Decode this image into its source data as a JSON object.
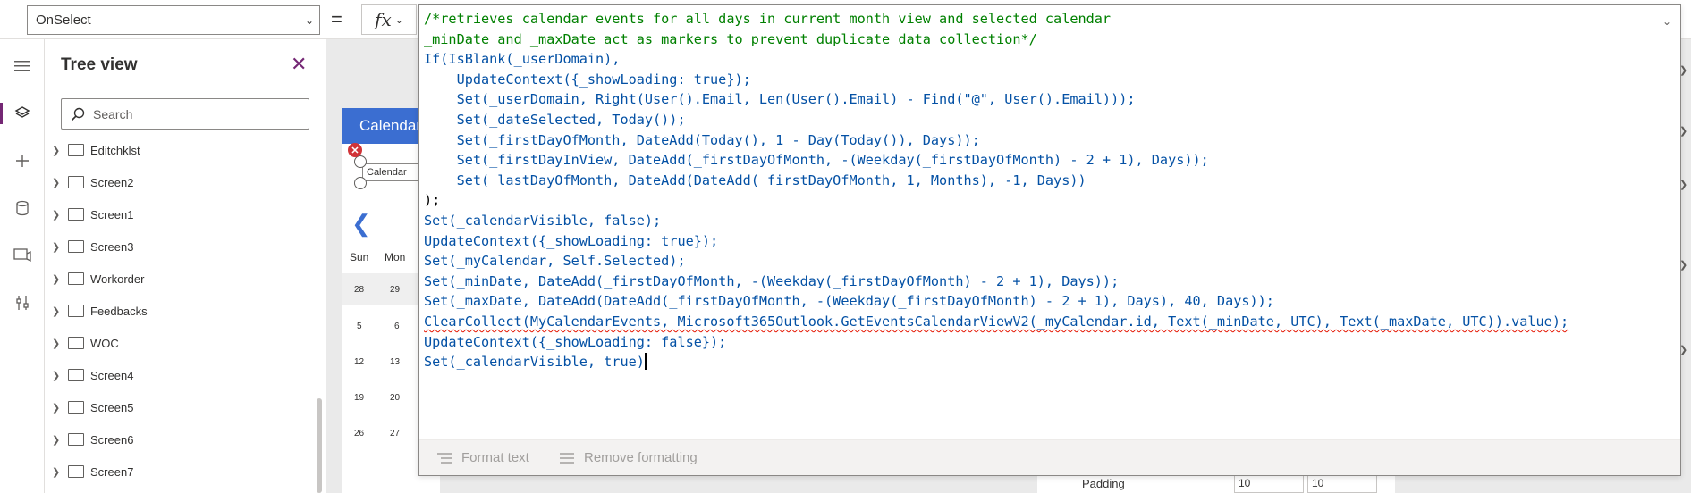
{
  "formula_bar": {
    "property": "OnSelect",
    "equals": "=",
    "fx": "fx"
  },
  "tree": {
    "title": "Tree view",
    "search_placeholder": "Search",
    "items": [
      {
        "label": "Editchklst"
      },
      {
        "label": "Screen2"
      },
      {
        "label": "Screen1"
      },
      {
        "label": "Screen3"
      },
      {
        "label": "Workorder"
      },
      {
        "label": "Feedbacks"
      },
      {
        "label": "WOC"
      },
      {
        "label": "Screen4"
      },
      {
        "label": "Screen5"
      },
      {
        "label": "Screen6"
      },
      {
        "label": "Screen7"
      }
    ]
  },
  "canvas": {
    "header": "Calendar",
    "chip": "Calendar",
    "days_of_week": [
      "Sun",
      "Mon"
    ],
    "day_rows": [
      [
        "28",
        "29"
      ],
      [
        "5",
        "6"
      ],
      [
        "12",
        "13"
      ],
      [
        "19",
        "20"
      ],
      [
        "26",
        "27"
      ]
    ]
  },
  "properties": {
    "padding_label": "Padding",
    "padding_values": [
      "10",
      "10"
    ]
  },
  "editor": {
    "lines": [
      "/*retrieves calendar events for all days in current month view and selected calendar",
      "_minDate and _maxDate act as markers to prevent duplicate data collection*/",
      "If(IsBlank(_userDomain),",
      "    UpdateContext({_showLoading: true});",
      "    Set(_userDomain, Right(User().Email, Len(User().Email) - Find(\"@\", User().Email)));",
      "    Set(_dateSelected, Today());",
      "    Set(_firstDayOfMonth, DateAdd(Today(), 1 - Day(Today()), Days));",
      "    Set(_firstDayInView, DateAdd(_firstDayOfMonth, -(Weekday(_firstDayOfMonth) - 2 + 1), Days));",
      "    Set(_lastDayOfMonth, DateAdd(DateAdd(_firstDayOfMonth, 1, Months), -1, Days))",
      ");",
      "Set(_calendarVisible, false);",
      "UpdateContext({_showLoading: true});",
      "Set(_myCalendar, Self.Selected);",
      "Set(_minDate, DateAdd(_firstDayOfMonth, -(Weekday(_firstDayOfMonth) - 2 + 1), Days));",
      "Set(_maxDate, DateAdd(DateAdd(_firstDayOfMonth, -(Weekday(_firstDayOfMonth) - 2 + 1), Days), 40, Days));",
      "ClearCollect(MyCalendarEvents, Microsoft365Outlook.GetEventsCalendarViewV2(_myCalendar.id, Text(_minDate, UTC), Text(_maxDate, UTC)).value);",
      "UpdateContext({_showLoading: false});",
      "Set(_calendarVisible, true)"
    ],
    "format_text": "Format text",
    "remove_formatting": "Remove formatting"
  }
}
